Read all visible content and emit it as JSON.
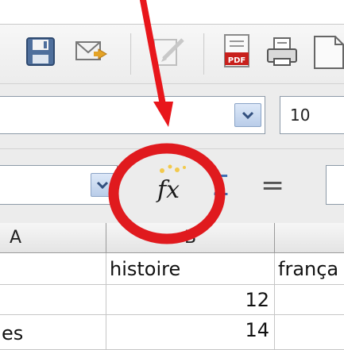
{
  "toolbar": {
    "icons": [
      "save-icon",
      "send-email-icon",
      "edit-file-icon",
      "export-pdf-icon",
      "print-icon",
      "page-preview-icon"
    ]
  },
  "formatting": {
    "font_size": "10"
  },
  "formula_bar": {
    "function_wizard_label": "fx",
    "sum_symbol": "Σ",
    "equals_symbol": "="
  },
  "columns": [
    {
      "label": "A"
    },
    {
      "label": "B"
    },
    {
      "label": ""
    }
  ],
  "rows": [
    [
      "",
      "histoire",
      "frança"
    ],
    [
      "",
      "12",
      ""
    ],
    [
      "es",
      "14",
      ""
    ]
  ],
  "annotation": {
    "arrow_color": "#e8161b",
    "circle_color": "#e01a1e"
  }
}
